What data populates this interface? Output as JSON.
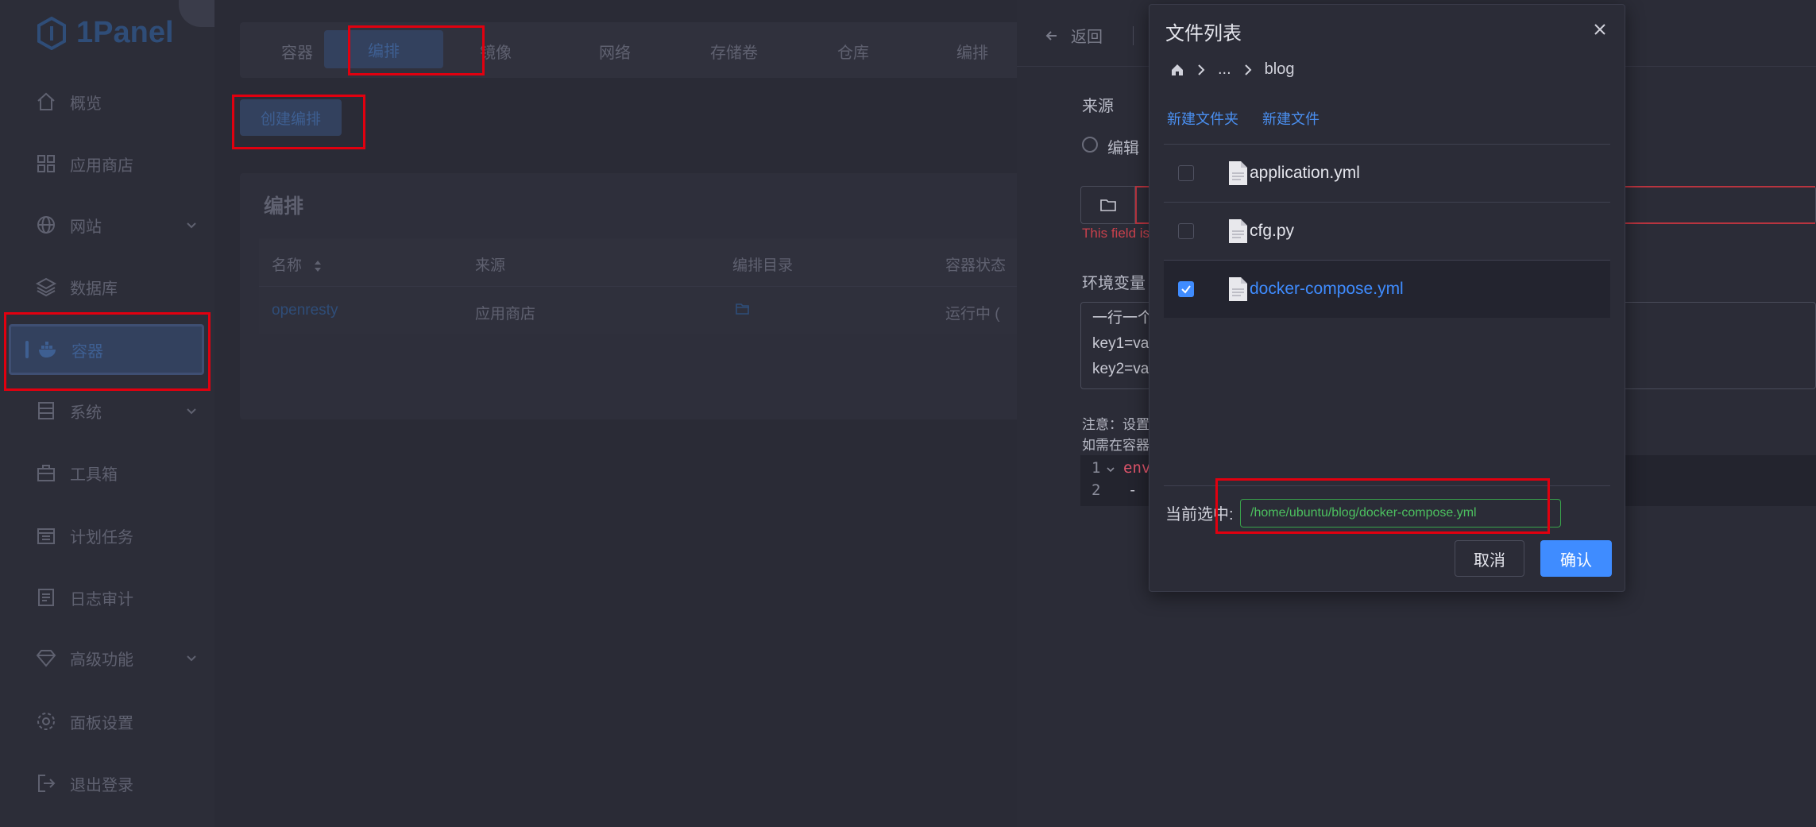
{
  "sidebar": {
    "logo_text": "1Panel",
    "items": [
      {
        "label": "概览",
        "icon": "home-icon"
      },
      {
        "label": "应用商店",
        "icon": "grid-icon"
      },
      {
        "label": "网站",
        "icon": "globe-icon",
        "has_submenu": true
      },
      {
        "label": "数据库",
        "icon": "layers-icon"
      },
      {
        "label": "容器",
        "icon": "docker-icon",
        "active": true
      },
      {
        "label": "系统",
        "icon": "server-icon",
        "has_submenu": true
      },
      {
        "label": "工具箱",
        "icon": "toolbox-icon"
      },
      {
        "label": "计划任务",
        "icon": "calendar-icon"
      },
      {
        "label": "日志审计",
        "icon": "log-icon"
      },
      {
        "label": "高级功能",
        "icon": "diamond-icon",
        "has_submenu": true
      },
      {
        "label": "面板设置",
        "icon": "gear-icon"
      },
      {
        "label": "退出登录",
        "icon": "logout-icon"
      }
    ]
  },
  "main": {
    "tabs": [
      "容器",
      "编排",
      "镜像",
      "网络",
      "存储卷",
      "仓库",
      "编排"
    ],
    "active_tab": "编排",
    "create_button": "创建编排",
    "panel_title": "编排",
    "table": {
      "headers": [
        "名称",
        "来源",
        "编排目录",
        "容器状态"
      ],
      "rows": [
        {
          "name": "openresty",
          "source": "应用商店",
          "dir_icon": "folder-open-icon",
          "status": "运行中 ("
        }
      ]
    }
  },
  "drawer": {
    "back_label": "返回",
    "source_label": "来源",
    "radio_edit_label": "编辑",
    "error_text": "This field is",
    "env_label": "环境变量",
    "env_lines": [
      "一行一个",
      "key1=va",
      "key2=va"
    ],
    "note_line1": "注意：设置",
    "note_line2": "如需在容器",
    "code_lines": [
      {
        "n": "1",
        "text": "env"
      },
      {
        "n": "2",
        "text": "-"
      }
    ]
  },
  "modal": {
    "title": "文件列表",
    "breadcrumb": {
      "ellipsis": "...",
      "current": "blog"
    },
    "new_folder": "新建文件夹",
    "new_file": "新建文件",
    "files": [
      {
        "name": "application.yml",
        "checked": false
      },
      {
        "name": "cfg.py",
        "checked": false
      },
      {
        "name": "docker-compose.yml",
        "checked": true
      }
    ],
    "current_label": "当前选中:",
    "current_value": "/home/ubuntu/blog/docker-compose.yml",
    "cancel_label": "取消",
    "confirm_label": "确认"
  },
  "colors": {
    "accent": "#3f8cff",
    "highlight": "#e1000f",
    "error": "#c9414c",
    "success": "#4cc05f"
  }
}
